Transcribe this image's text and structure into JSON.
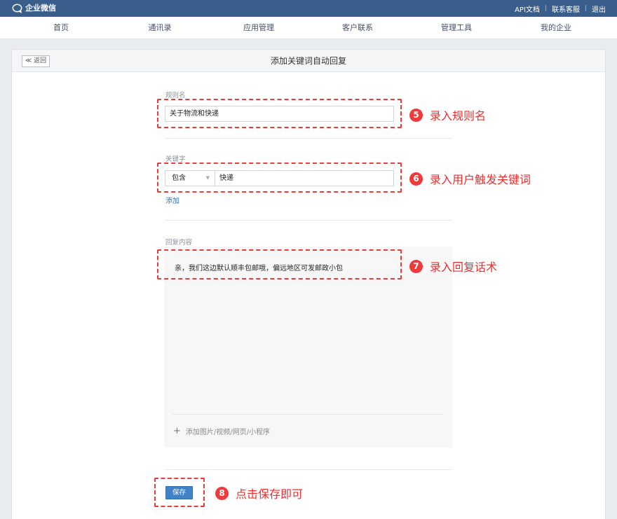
{
  "app": {
    "name": "企业微信"
  },
  "toplinks": {
    "api_docs": "API文档",
    "support": "联系客服",
    "logout": "退出"
  },
  "nav": {
    "items": [
      {
        "label": "首页"
      },
      {
        "label": "通讯录"
      },
      {
        "label": "应用管理"
      },
      {
        "label": "客户联系"
      },
      {
        "label": "管理工具"
      },
      {
        "label": "我的企业"
      }
    ]
  },
  "panel": {
    "back_label": "≪ 返回",
    "title": "添加关键词自动回复"
  },
  "form": {
    "rule_name_label": "规则名",
    "rule_name_value": "关于物流和快递",
    "keyword_label": "关键字",
    "keyword_match": "包含",
    "keyword_value": "快递",
    "add_keyword_label": "添加",
    "reply_label": "回复内容",
    "reply_text": "亲，我们这边默认顺丰包邮哦，偏远地区可发邮政小包",
    "add_media_label": "添加图片/视频/网页/小程序",
    "save_label": "保存"
  },
  "annotations": [
    {
      "number": "5",
      "text": "录入规则名"
    },
    {
      "number": "6",
      "text": "录入用户触发关键词"
    },
    {
      "number": "7",
      "text": "录入回复话术"
    },
    {
      "number": "8",
      "text": "点击保存即可"
    }
  ],
  "colors": {
    "topbar": "#3a5e8c",
    "annotation_red": "#ee3a3a",
    "save_button": "#3f82c6",
    "link_blue": "#3a6ea8"
  }
}
